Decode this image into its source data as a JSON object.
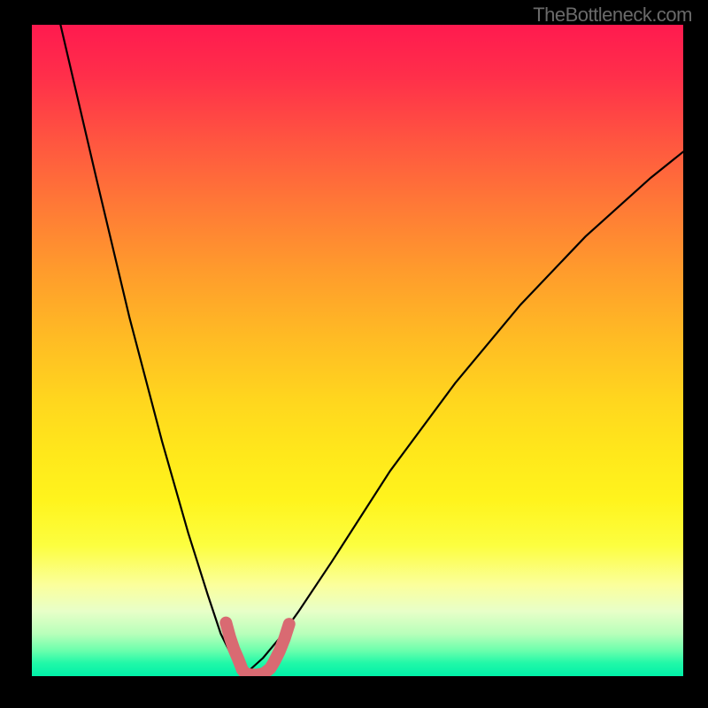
{
  "watermark": "TheBottleneck.com",
  "chart_data": {
    "type": "line",
    "title": "",
    "xlabel": "",
    "ylabel": "",
    "xlim": [
      0,
      1
    ],
    "ylim": [
      0,
      1
    ],
    "grid": false,
    "legend": "none",
    "annotations": [
      "TheBottleneck.com"
    ],
    "series": [
      {
        "name": "curve",
        "color": "#000000",
        "x": [
          0.044,
          0.1,
          0.15,
          0.2,
          0.24,
          0.27,
          0.29,
          0.305,
          0.315,
          0.32,
          0.325,
          0.335,
          0.355,
          0.38,
          0.41,
          0.46,
          0.55,
          0.65,
          0.75,
          0.85,
          0.95,
          1.0
        ],
        "y": [
          1.0,
          0.76,
          0.55,
          0.36,
          0.22,
          0.125,
          0.065,
          0.035,
          0.015,
          0.005,
          0.005,
          0.01,
          0.028,
          0.058,
          0.1,
          0.175,
          0.315,
          0.45,
          0.57,
          0.675,
          0.765,
          0.805
        ]
      },
      {
        "name": "highlight",
        "color": "#d96a72",
        "type": "path",
        "points_xy": [
          [
            0.298,
            0.082
          ],
          [
            0.304,
            0.06
          ],
          [
            0.31,
            0.042
          ],
          [
            0.316,
            0.028
          ],
          [
            0.32,
            0.018
          ],
          [
            0.323,
            0.01
          ],
          [
            0.328,
            0.004
          ],
          [
            0.336,
            0.002
          ],
          [
            0.346,
            0.002
          ],
          [
            0.356,
            0.004
          ],
          [
            0.366,
            0.012
          ],
          [
            0.372,
            0.022
          ],
          [
            0.38,
            0.038
          ],
          [
            0.388,
            0.058
          ],
          [
            0.395,
            0.08
          ]
        ]
      }
    ],
    "background_gradient": {
      "direction": "vertical",
      "stops": [
        {
          "pos": 0.0,
          "color": "#ff1a4f"
        },
        {
          "pos": 0.5,
          "color": "#ffc81f"
        },
        {
          "pos": 0.8,
          "color": "#fcfe40"
        },
        {
          "pos": 1.0,
          "color": "#00f0a8"
        }
      ]
    }
  }
}
